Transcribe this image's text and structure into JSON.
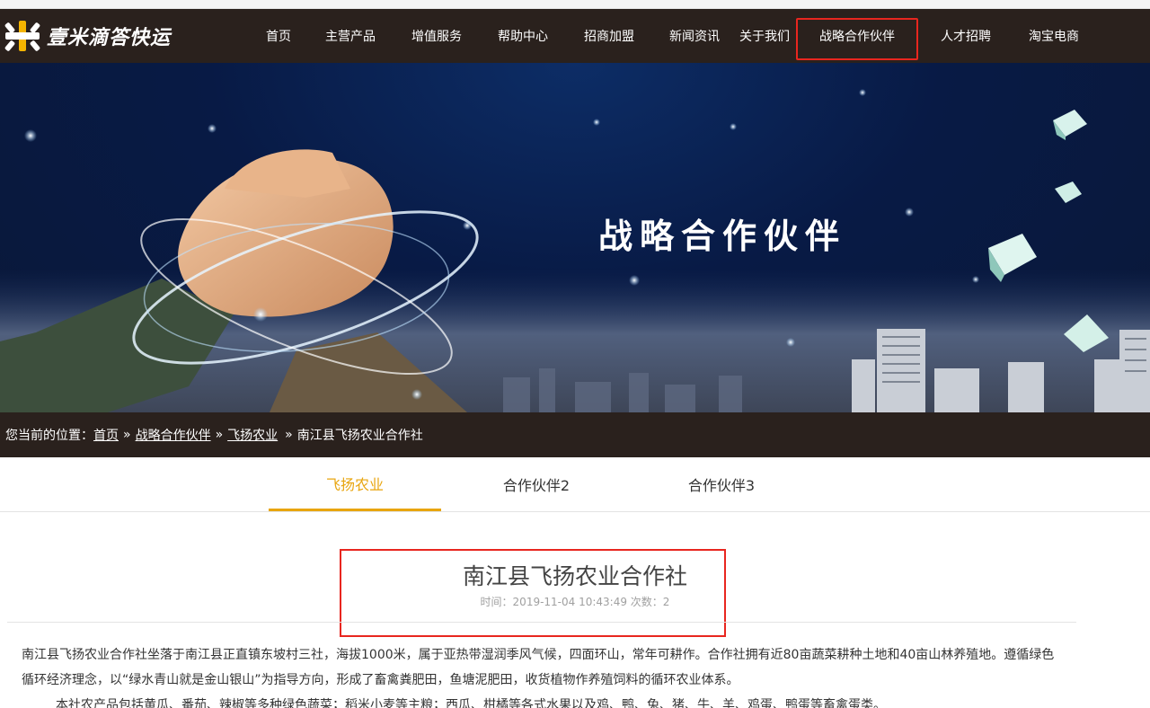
{
  "brand": {
    "name": "壹米滴答快运"
  },
  "nav": {
    "items": [
      {
        "label": "首页"
      },
      {
        "label": "主营产品"
      },
      {
        "label": "增值服务"
      },
      {
        "label": "帮助中心"
      },
      {
        "label": "招商加盟"
      },
      {
        "label": "新闻资讯"
      },
      {
        "label": "关于我们"
      },
      {
        "label": "战略合作伙伴",
        "active": true
      },
      {
        "label": "人才招聘"
      },
      {
        "label": "淘宝电商"
      }
    ]
  },
  "banner": {
    "title": "战略合作伙伴"
  },
  "breadcrumb": {
    "prefix": "您当前的位置：",
    "links": [
      "首页",
      "战略合作伙伴",
      "飞扬农业"
    ],
    "current": "南江县飞扬农业合作社",
    "separator": "»"
  },
  "tabs": [
    {
      "label": "飞扬农业",
      "active": true
    },
    {
      "label": "合作伙伴2"
    },
    {
      "label": "合作伙伴3"
    }
  ],
  "article": {
    "title": "南江县飞扬农业合作社",
    "meta": "时间：2019-11-04 10:43:49 次数：2",
    "paragraphs": [
      "南江县飞扬农业合作社坐落于南江县正直镇东坡村三社，海拔1000米，属于亚热带湿润季风气候，四面环山，常年可耕作。合作社拥有近80亩蔬菜耕种土地和40亩山林养殖地。遵循绿色循环经济理念，以“绿水青山就是金山银山”为指导方向，形成了畜禽粪肥田，鱼塘泥肥田，收货植物作养殖饲料的循环农业体系。",
      "本社农产品包括黄瓜、番茄、辣椒等多种绿色蔬菜；稻米小麦等主粮；西瓜、柑橘等各式水果以及鸡、鸭、兔、猪、牛、羊、鸡蛋、鸭蛋等畜禽蛋类。"
    ]
  },
  "colors": {
    "header_bg": "#2a211d",
    "accent": "#e8a50f",
    "highlight": "#e8261f"
  }
}
